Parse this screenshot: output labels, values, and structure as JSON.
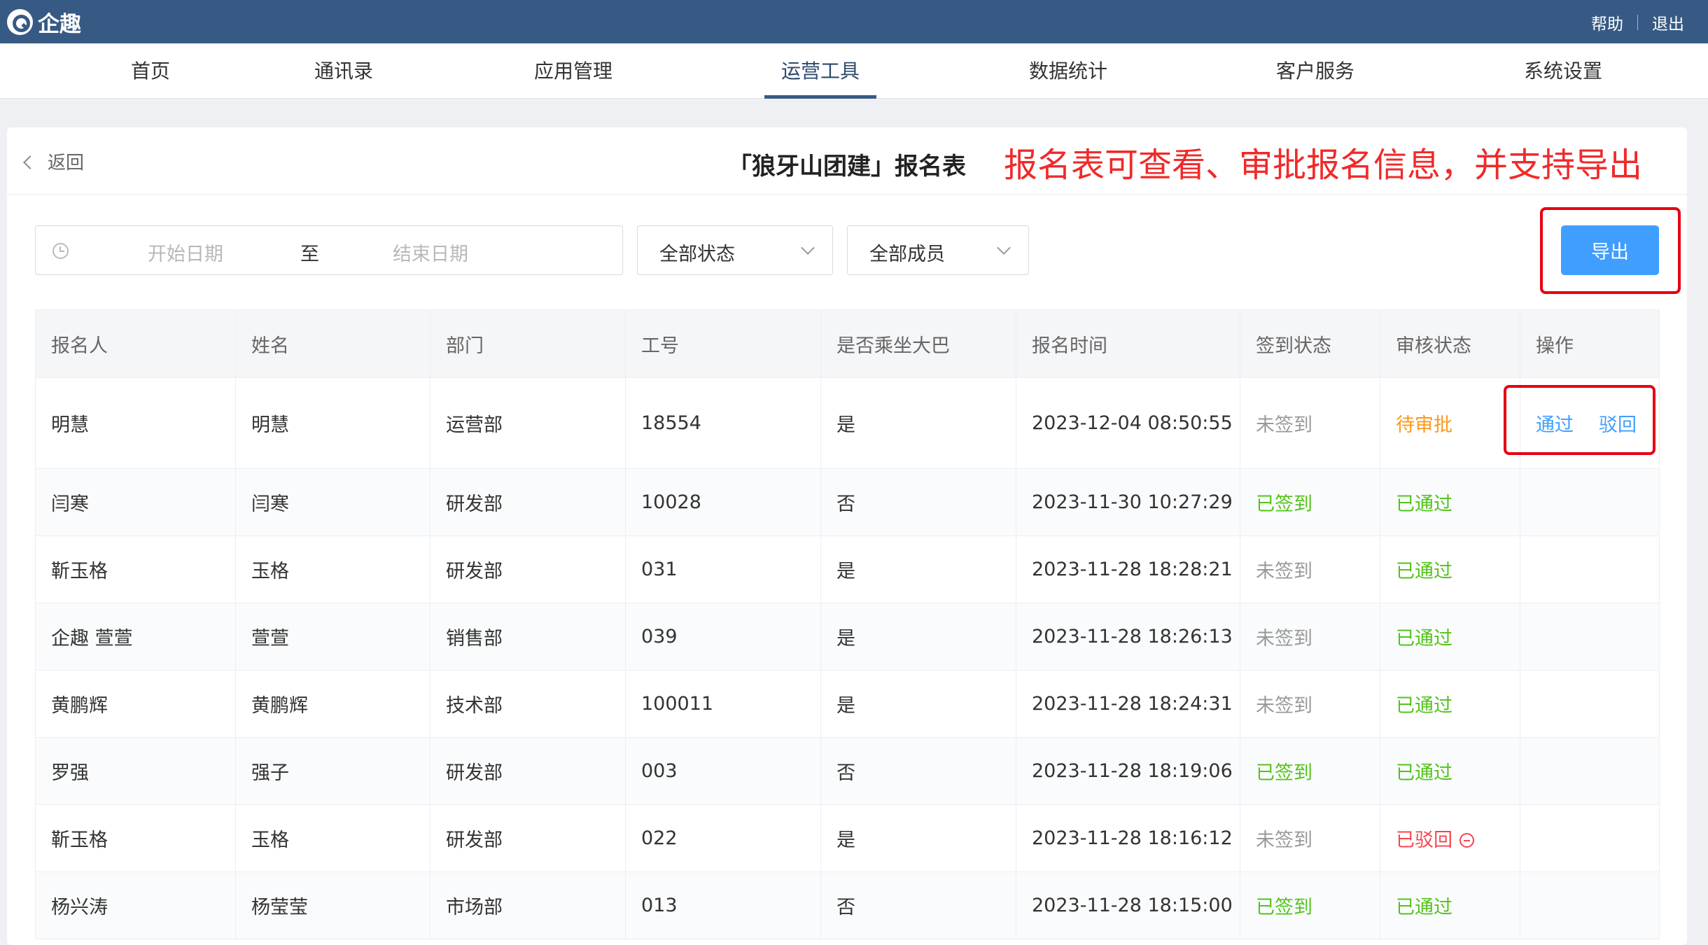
{
  "app": {
    "brand": "企趣"
  },
  "top_links": {
    "help": "帮助",
    "logout": "退出"
  },
  "nav": {
    "active": "运营工具",
    "items": [
      "首页",
      "通讯录",
      "应用管理",
      "运营工具",
      "数据统计",
      "客户服务",
      "系统设置"
    ]
  },
  "header": {
    "back_label": "返回",
    "title": "「狼牙山团建」报名表",
    "annotation": "报名表可查看、审批报名信息，并支持导出"
  },
  "filters": {
    "date_start_placeholder": "开始日期",
    "date_separator": "至",
    "date_end_placeholder": "结束日期",
    "status_select": "全部状态",
    "member_select": "全部成员"
  },
  "toolbar": {
    "export_label": "导出"
  },
  "table": {
    "headers": [
      "报名人",
      "姓名",
      "部门",
      "工号",
      "是否乘坐大巴",
      "报名时间",
      "签到状态",
      "审核状态",
      "操作"
    ],
    "actions": {
      "approve": "通过",
      "reject": "驳回"
    },
    "rows": [
      {
        "registrant": "明慧",
        "name": "明慧",
        "dept": "运营部",
        "id": "18554",
        "bus": "是",
        "time": "2023-12-04 08:50:55",
        "checkin": "未签到",
        "review": "待审批"
      },
      {
        "registrant": "闫寒",
        "name": "闫寒",
        "dept": "研发部",
        "id": "10028",
        "bus": "否",
        "time": "2023-11-30 10:27:29",
        "checkin": "已签到",
        "review": "已通过"
      },
      {
        "registrant": "靳玉格",
        "name": "玉格",
        "dept": "研发部",
        "id": "031",
        "bus": "是",
        "time": "2023-11-28 18:28:21",
        "checkin": "未签到",
        "review": "已通过"
      },
      {
        "registrant": "企趣 萱萱",
        "name": "萱萱",
        "dept": "销售部",
        "id": "039",
        "bus": "是",
        "time": "2023-11-28 18:26:13",
        "checkin": "未签到",
        "review": "已通过"
      },
      {
        "registrant": "黄鹏辉",
        "name": "黄鹏辉",
        "dept": "技术部",
        "id": "100011",
        "bus": "是",
        "time": "2023-11-28 18:24:31",
        "checkin": "未签到",
        "review": "已通过"
      },
      {
        "registrant": "罗强",
        "name": "强子",
        "dept": "研发部",
        "id": "003",
        "bus": "否",
        "time": "2023-11-28 18:19:06",
        "checkin": "已签到",
        "review": "已通过"
      },
      {
        "registrant": "靳玉格",
        "name": "玉格",
        "dept": "研发部",
        "id": "022",
        "bus": "是",
        "time": "2023-11-28 18:16:12",
        "checkin": "未签到",
        "review": "已驳回"
      },
      {
        "registrant": "杨兴涛",
        "name": "杨莹莹",
        "dept": "市场部",
        "id": "013",
        "bus": "否",
        "time": "2023-11-28 18:15:00",
        "checkin": "已签到",
        "review": "已通过"
      }
    ]
  },
  "colors": {
    "topbar": "#375a84",
    "accent": "#409eff",
    "pending": "#fa9a1c",
    "approved": "#52c41a",
    "rejected": "#f5454b",
    "annotation": "#f02a2a"
  }
}
